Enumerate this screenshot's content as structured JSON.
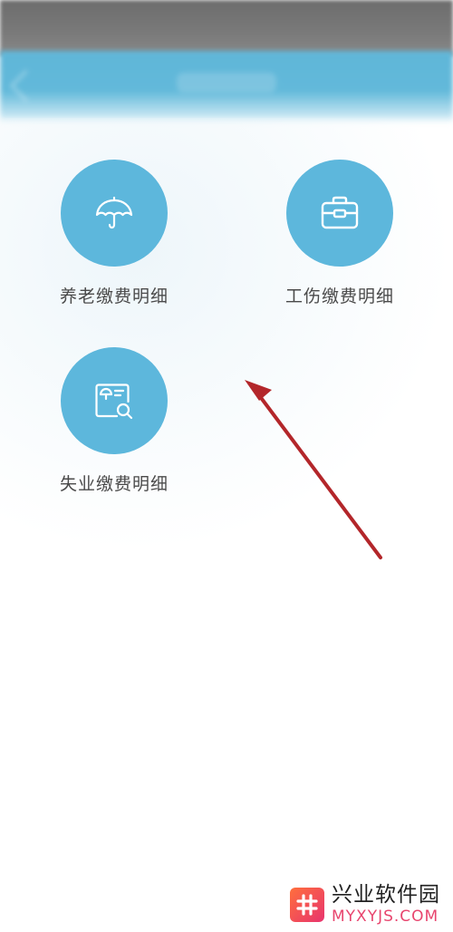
{
  "colors": {
    "accent_circle": "#5db7dc",
    "nav_blue": "#62b9da",
    "label_text": "#4a4a4a",
    "arrow": "#b3262a",
    "watermark_pink": "#e8456e"
  },
  "menu": {
    "items": [
      {
        "label": "养老缴费明细",
        "icon": "umbrella-icon"
      },
      {
        "label": "工伤缴费明细",
        "icon": "briefcase-icon"
      },
      {
        "label": "失业缴费明细",
        "icon": "document-search-icon"
      }
    ]
  },
  "watermark": {
    "name": "兴业软件园",
    "domain": "MYXYJS.COM",
    "icon": "hash-icon"
  }
}
